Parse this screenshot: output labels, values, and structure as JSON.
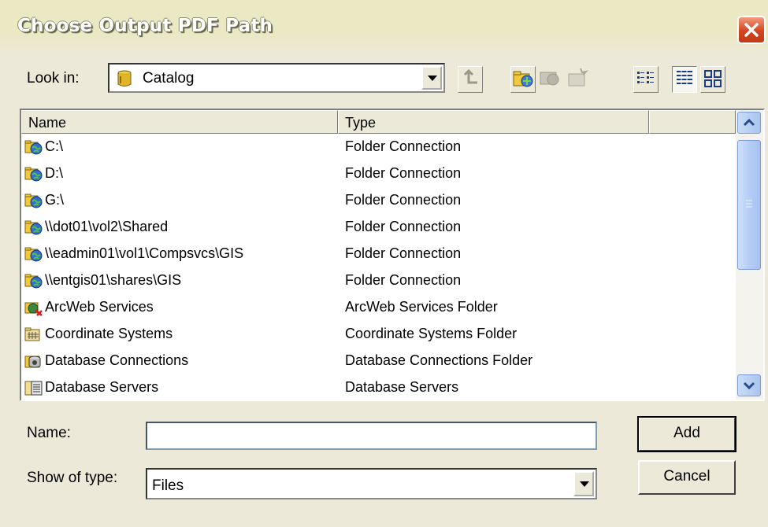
{
  "window": {
    "title": "Choose Output PDF Path"
  },
  "lookin": {
    "label": "Look in:",
    "value": "Catalog"
  },
  "columns": [
    {
      "label": "Name"
    },
    {
      "label": "Type"
    },
    {
      "label": ""
    }
  ],
  "items": [
    {
      "name": "C:\\",
      "type": "Folder Connection",
      "icon": "folder-connection-icon"
    },
    {
      "name": "D:\\",
      "type": "Folder Connection",
      "icon": "folder-connection-icon"
    },
    {
      "name": "G:\\",
      "type": "Folder Connection",
      "icon": "folder-connection-icon"
    },
    {
      "name": "\\\\dot01\\vol2\\Shared",
      "type": "Folder Connection",
      "icon": "folder-connection-icon"
    },
    {
      "name": "\\\\eadmin01\\vol1\\Compsvcs\\GIS",
      "type": "Folder Connection",
      "icon": "folder-connection-icon"
    },
    {
      "name": "\\\\entgis01\\shares\\GIS",
      "type": "Folder Connection",
      "icon": "folder-connection-icon"
    },
    {
      "name": "ArcWeb Services",
      "type": "ArcWeb Services Folder",
      "icon": "arcweb-services-icon"
    },
    {
      "name": "Coordinate Systems",
      "type": "Coordinate Systems Folder",
      "icon": "coordinate-systems-icon"
    },
    {
      "name": "Database Connections",
      "type": "Database Connections Folder",
      "icon": "database-connections-icon"
    },
    {
      "name": "Database Servers",
      "type": "Database Servers",
      "icon": "database-servers-icon"
    }
  ],
  "name_field": {
    "label": "Name:",
    "value": ""
  },
  "type_field": {
    "label": "Show of type:",
    "value": "Files"
  },
  "buttons": {
    "add": "Add",
    "cancel": "Cancel"
  }
}
